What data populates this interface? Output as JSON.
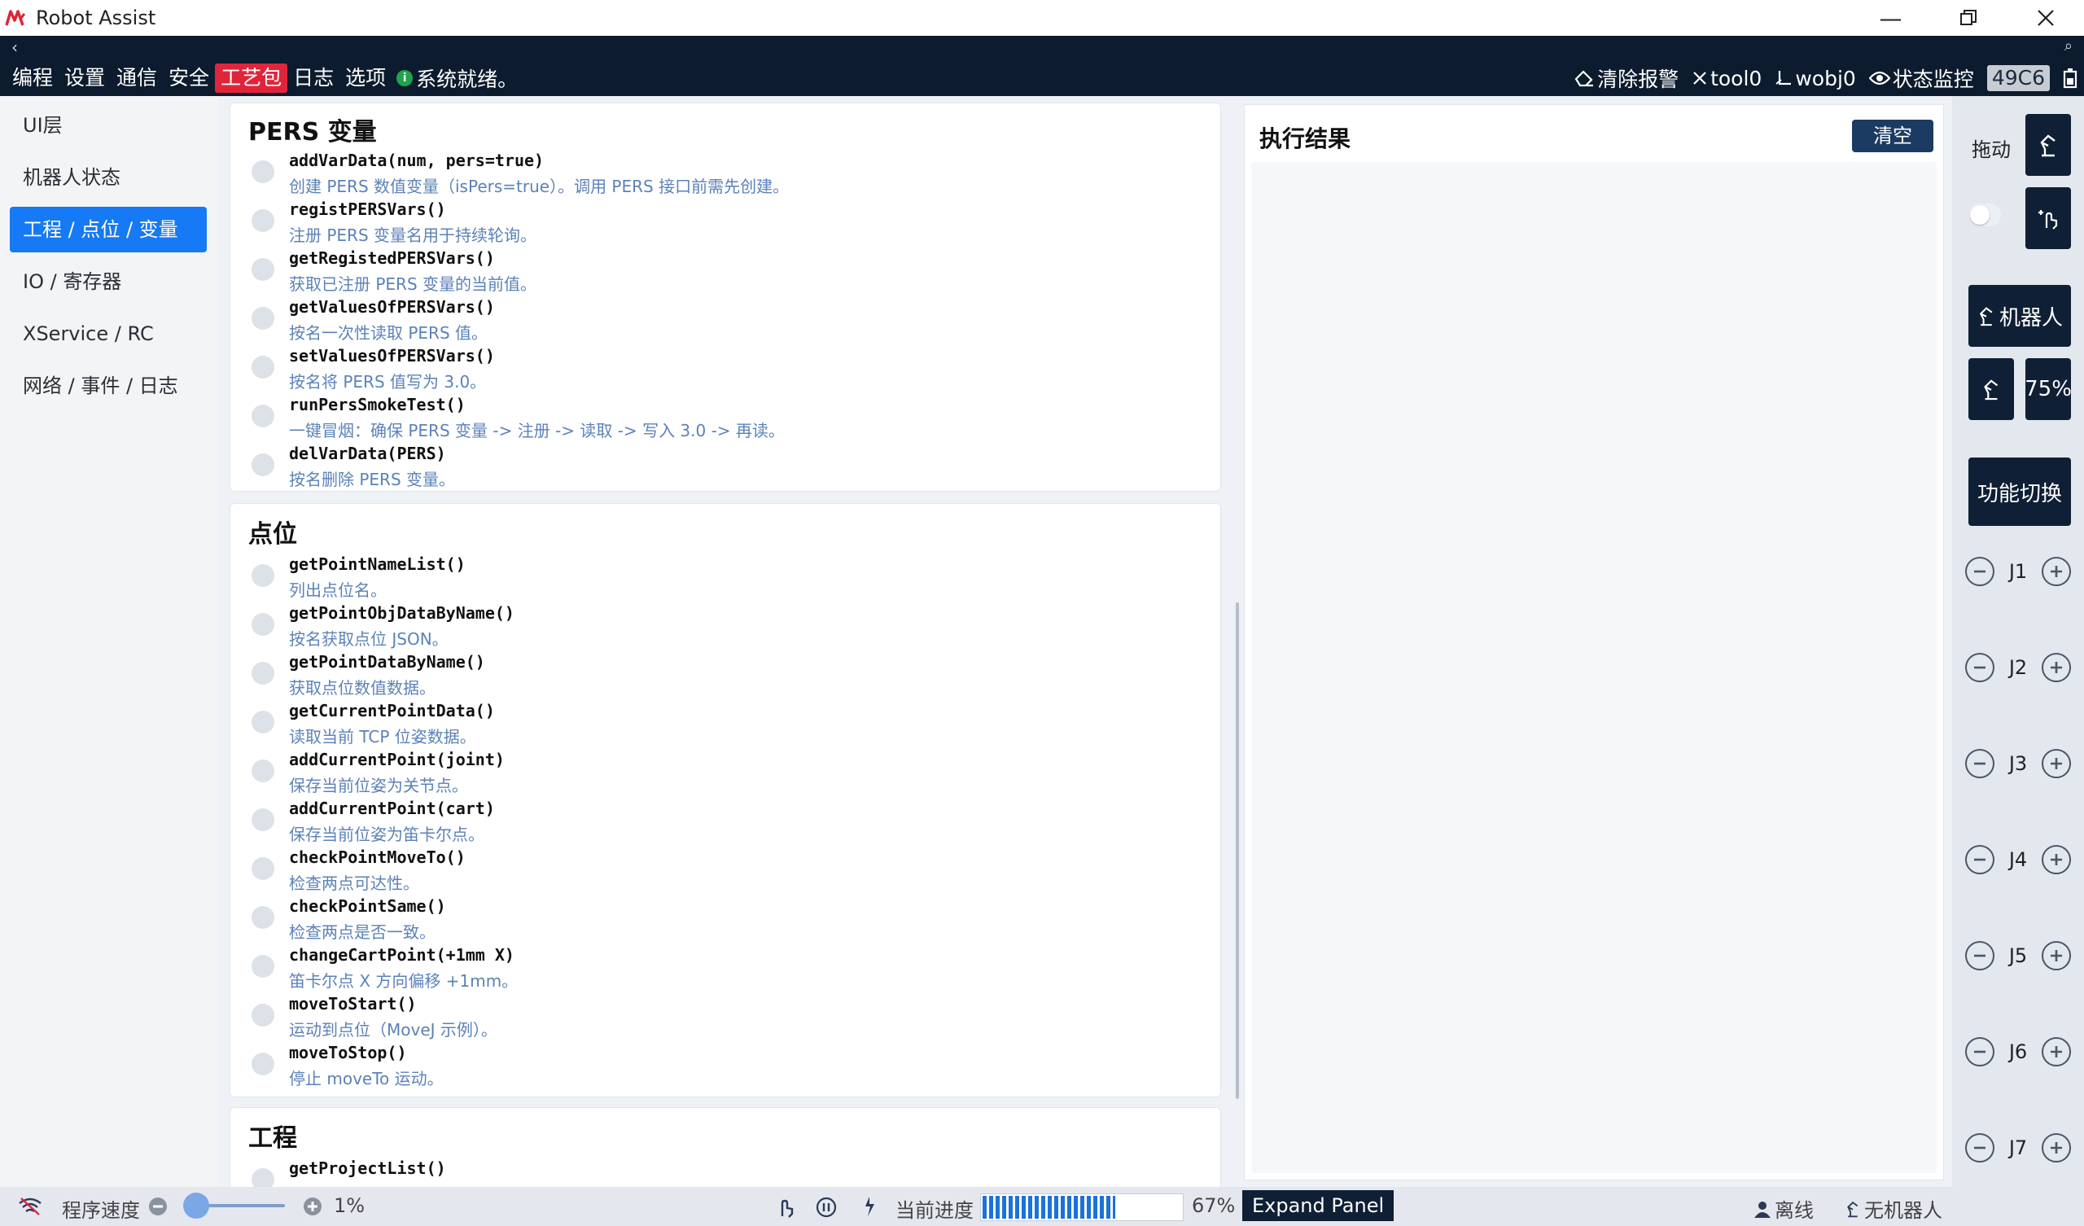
{
  "window": {
    "title": "Robot Assist",
    "brand_color": "#e0253b"
  },
  "navbar": {
    "back_icon": "‹",
    "search_icon": "⌕",
    "menu": [
      "编程",
      "设置",
      "通信",
      "安全",
      "工艺包",
      "日志",
      "选项"
    ],
    "active_menu": "工艺包",
    "status_text": "系统就绪。",
    "tools": {
      "clear_alarm": "清除报警",
      "tool": "tool0",
      "wobj": "wobj0",
      "monitor": "状态监控",
      "code": "49C6"
    }
  },
  "sidebar": {
    "items": [
      {
        "label": "UI层"
      },
      {
        "label": "机器人状态"
      },
      {
        "label": "工程 / 点位 / 变量"
      },
      {
        "label": "IO / 寄存器"
      },
      {
        "label": "XService / RC"
      },
      {
        "label": "网络 / 事件 / 日志"
      }
    ],
    "active_label": "工程 / 点位 / 变量"
  },
  "sections": {
    "pers": {
      "title": "PERS 变量",
      "rows": [
        {
          "fn": "addVarData(num, pers=true)",
          "desc": "创建 PERS 数值变量（isPers=true）。调用 PERS 接口前需先创建。"
        },
        {
          "fn": "registPERSVars()",
          "desc": "注册 PERS 变量名用于持续轮询。"
        },
        {
          "fn": "getRegistedPERSVars()",
          "desc": "获取已注册 PERS 变量的当前值。"
        },
        {
          "fn": "getValuesOfPERSVars()",
          "desc": "按名一次性读取 PERS 值。"
        },
        {
          "fn": "setValuesOfPERSVars()",
          "desc": "按名将 PERS 值写为 3.0。"
        },
        {
          "fn": "runPersSmokeTest()",
          "desc": "一键冒烟：确保 PERS 变量 -> 注册 -> 读取 -> 写入 3.0 -> 再读。"
        },
        {
          "fn": "delVarData(PERS)",
          "desc": "按名删除 PERS 变量。"
        }
      ]
    },
    "points": {
      "title": "点位",
      "rows": [
        {
          "fn": "getPointNameList()",
          "desc": "列出点位名。"
        },
        {
          "fn": "getPointObjDataByName()",
          "desc": "按名获取点位 JSON。"
        },
        {
          "fn": "getPointDataByName()",
          "desc": "获取点位数值数据。"
        },
        {
          "fn": "getCurrentPointData()",
          "desc": "读取当前 TCP 位姿数据。"
        },
        {
          "fn": "addCurrentPoint(joint)",
          "desc": "保存当前位姿为关节点。"
        },
        {
          "fn": "addCurrentPoint(cart)",
          "desc": "保存当前位姿为笛卡尔点。"
        },
        {
          "fn": "checkPointMoveTo()",
          "desc": "检查两点可达性。"
        },
        {
          "fn": "checkPointSame()",
          "desc": "检查两点是否一致。"
        },
        {
          "fn": "changeCartPoint(+1mm X)",
          "desc": "笛卡尔点 X 方向偏移 +1mm。"
        },
        {
          "fn": "moveToStart()",
          "desc": "运动到点位（MoveJ 示例）。"
        },
        {
          "fn": "moveToStop()",
          "desc": "停止 moveTo 运动。"
        }
      ]
    },
    "project": {
      "title": "工程",
      "rows": [
        {
          "fn": "getProjectList()",
          "desc": ""
        }
      ]
    }
  },
  "result": {
    "title": "执行结果",
    "clear_label": "清空"
  },
  "right_panel": {
    "drag_label": "拖动",
    "robot_label": "机器人",
    "speed_value": "75%",
    "switch_label": "功能切换",
    "joints": [
      "J1",
      "J2",
      "J3",
      "J4",
      "J5",
      "J6",
      "J7"
    ]
  },
  "bottom": {
    "program_speed_label": "程序速度",
    "speed_percent": "1%",
    "speed_fraction": 0.01,
    "progress_label": "当前进度",
    "progress_percent": "67%",
    "progress_fraction": 0.67,
    "expand_label": "Expand Panel",
    "offline_label": "离线",
    "no_robot_label": "无机器人"
  }
}
